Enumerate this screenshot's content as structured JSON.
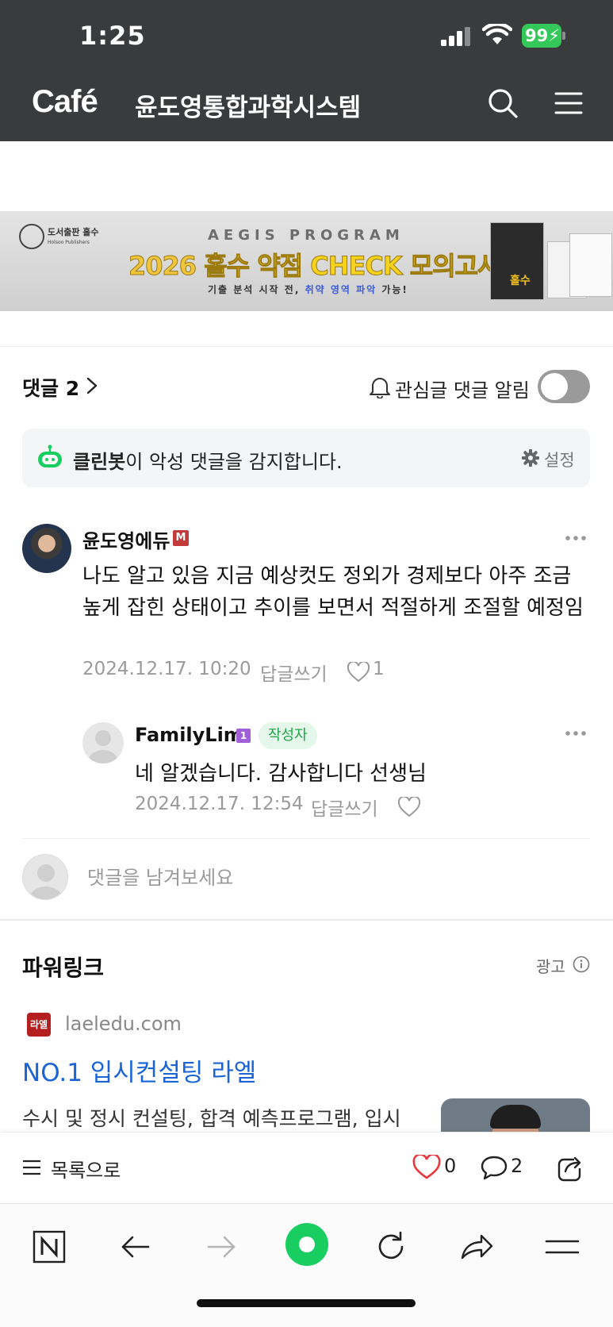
{
  "status": {
    "time": "1:25",
    "battery": "99"
  },
  "header": {
    "logo": "Café",
    "cafe_name": "윤도영통합과학시스템"
  },
  "banner": {
    "publisher": "도서출판 홀수",
    "publisher_en": "Holsoo Publishers",
    "program": "AEGIS PROGRAM",
    "title_part1": "2026 홀수 ",
    "title_part2": "약점 CHECK 모의고사",
    "sub_part1": "기출 분석 시작 전, ",
    "sub_part2": "취약 영역 파악",
    "sub_part3": " 가능!",
    "book_label": "홀수"
  },
  "comments_header": {
    "label": "댓글 2",
    "notify_label": "관심글 댓글 알림",
    "notify_on": false
  },
  "cleanbot": {
    "name": "클린봇",
    "text": "이 악성 댓글을 감지합니다.",
    "settings": "설정"
  },
  "comments": [
    {
      "author": "윤도영에듀",
      "badge": "M",
      "text": "나도 알고 있음 지금 예상컷도 정외가 경제보다 아주 조금 높게 잡힌 상태이고 추이를 보면서 적절하게 조절할 예정임",
      "date": "2024.12.17. 10:20",
      "reply_label": "답글쓰기",
      "likes": "1"
    },
    {
      "author": "FamilyLim",
      "badge": "1",
      "tag": "작성자",
      "text": "네 알겠습니다. 감사합니다 선생님",
      "date": "2024.12.17. 12:54",
      "reply_label": "답글쓰기"
    }
  ],
  "comment_input": {
    "placeholder": "댓글을 남겨보세요"
  },
  "powerlink": {
    "title": "파워링크",
    "ad_label": "광고",
    "favicon_text": "라엘",
    "domain": "laeledu.com",
    "headline": "NO.1 입시컨설팅 라엘",
    "description": "수시 및 정시 컨설팅, 합격 예측프로그램, 입시"
  },
  "action_bar": {
    "list_label": "목록으로",
    "likes": "0",
    "comments": "2"
  },
  "colors": {
    "header_bg": "#3a3b3d",
    "naver_green": "#19ce60",
    "link_blue": "#1a64d8",
    "heart_red": "#e8383d"
  }
}
